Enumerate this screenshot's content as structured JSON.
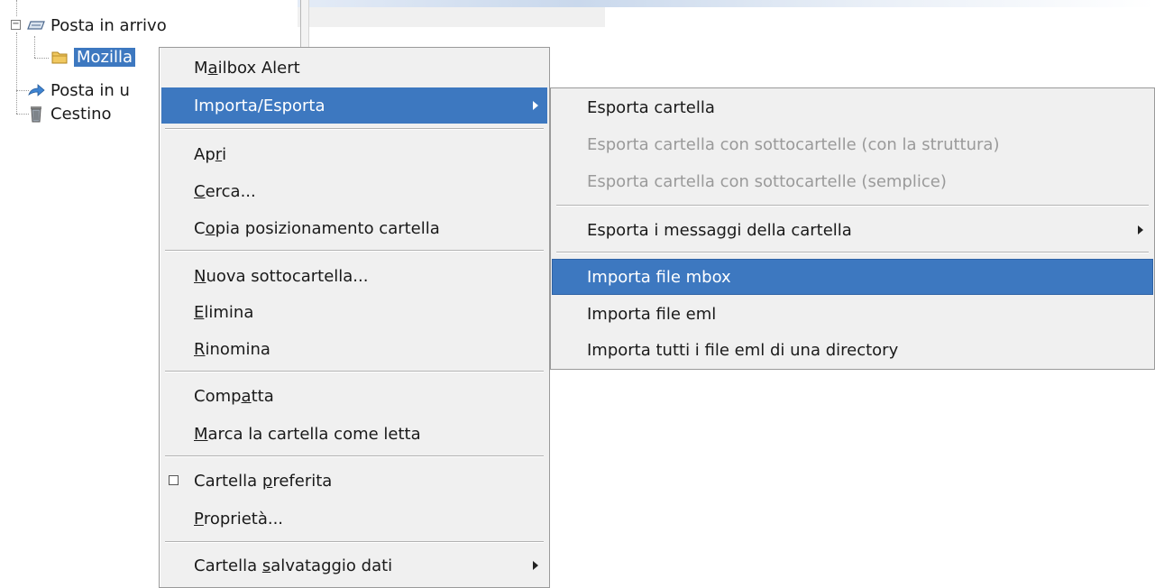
{
  "tree": {
    "items": [
      {
        "label": "Posta in arrivo",
        "icon": "inbox-tray-icon"
      },
      {
        "label": "Mozilla",
        "icon": "folder-icon"
      },
      {
        "label": "Posta in u",
        "icon": "sent-arrow-icon"
      },
      {
        "label": "Cestino",
        "icon": "trash-icon"
      }
    ]
  },
  "context_menu": {
    "mailbox_alert": {
      "pre": "M",
      "acc": "a",
      "post": "ilbox Alert"
    },
    "importa_esporta": "Importa/Esporta",
    "apri": {
      "pre": "Ap",
      "acc": "r",
      "post": "i"
    },
    "cerca": {
      "pre": "",
      "acc": "C",
      "post": "erca..."
    },
    "copia": {
      "pre": "C",
      "acc": "o",
      "post": "pia posizionamento cartella"
    },
    "nuova": {
      "pre": "",
      "acc": "N",
      "post": "uova sottocartella..."
    },
    "elimina": {
      "pre": "",
      "acc": "E",
      "post": "limina"
    },
    "rinomina": {
      "pre": "",
      "acc": "R",
      "post": "inomina"
    },
    "compatta": {
      "pre": "Comp",
      "acc": "a",
      "post": "tta"
    },
    "marca": {
      "pre": "",
      "acc": "M",
      "post": "arca la cartella come letta"
    },
    "preferita": {
      "pre": "Cartella ",
      "acc": "p",
      "post": "referita"
    },
    "proprieta": {
      "pre": "",
      "acc": "P",
      "post": "roprietà..."
    },
    "salvataggio": {
      "pre": "Cartella ",
      "acc": "s",
      "post": "alvataggio dati"
    }
  },
  "submenu": {
    "esporta_cartella": "Esporta cartella",
    "esporta_struttura": "Esporta cartella con sottocartelle (con la struttura)",
    "esporta_semplice": "Esporta cartella con sottocartelle (semplice)",
    "esporta_messaggi": "Esporta i messaggi della cartella",
    "importa_mbox": "Importa file mbox",
    "importa_eml": "Importa file eml",
    "importa_directory": "Importa tutti i file eml di una directory"
  },
  "colors": {
    "highlight": "#3d78c0",
    "menu_bg": "#f0f0f0"
  }
}
